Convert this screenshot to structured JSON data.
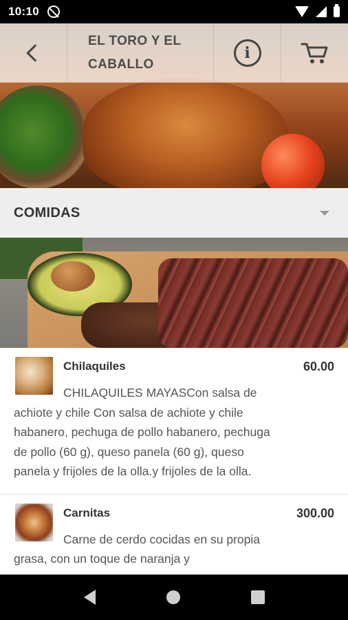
{
  "status_bar": {
    "time": "10:10",
    "icons": [
      "do-not-disturb-icon",
      "wifi-icon",
      "signal-icon",
      "battery-icon"
    ]
  },
  "app_bar": {
    "title_line1": "EL TORO Y EL",
    "title_line2": "CABALLO",
    "icons": [
      "back-icon",
      "info-icon",
      "cart-icon"
    ]
  },
  "category": {
    "label": "COMIDAS"
  },
  "menu": {
    "items": [
      {
        "name": "Chilaquiles",
        "price": "60.00",
        "description": "CHILAQUILES MAYASCon salsa de achiote y chile Con salsa de achiote y chile habanero, pechuga de pollo habanero, pechuga de pollo (60 g), queso panela (60 g), queso panela y frijoles de la olla.y frijoles de la olla."
      },
      {
        "name": "Carnitas",
        "price": "300.00",
        "description": "Carne de cerdo cocidas en su propia grasa, con un toque de naranja y"
      }
    ]
  },
  "nav_bar": {
    "icons": [
      "nav-back-icon",
      "nav-home-icon",
      "nav-recents-icon"
    ]
  },
  "colors": {
    "category_bar_bg": "#eeeeee",
    "text_dark": "#333333",
    "text_body": "#555555"
  }
}
